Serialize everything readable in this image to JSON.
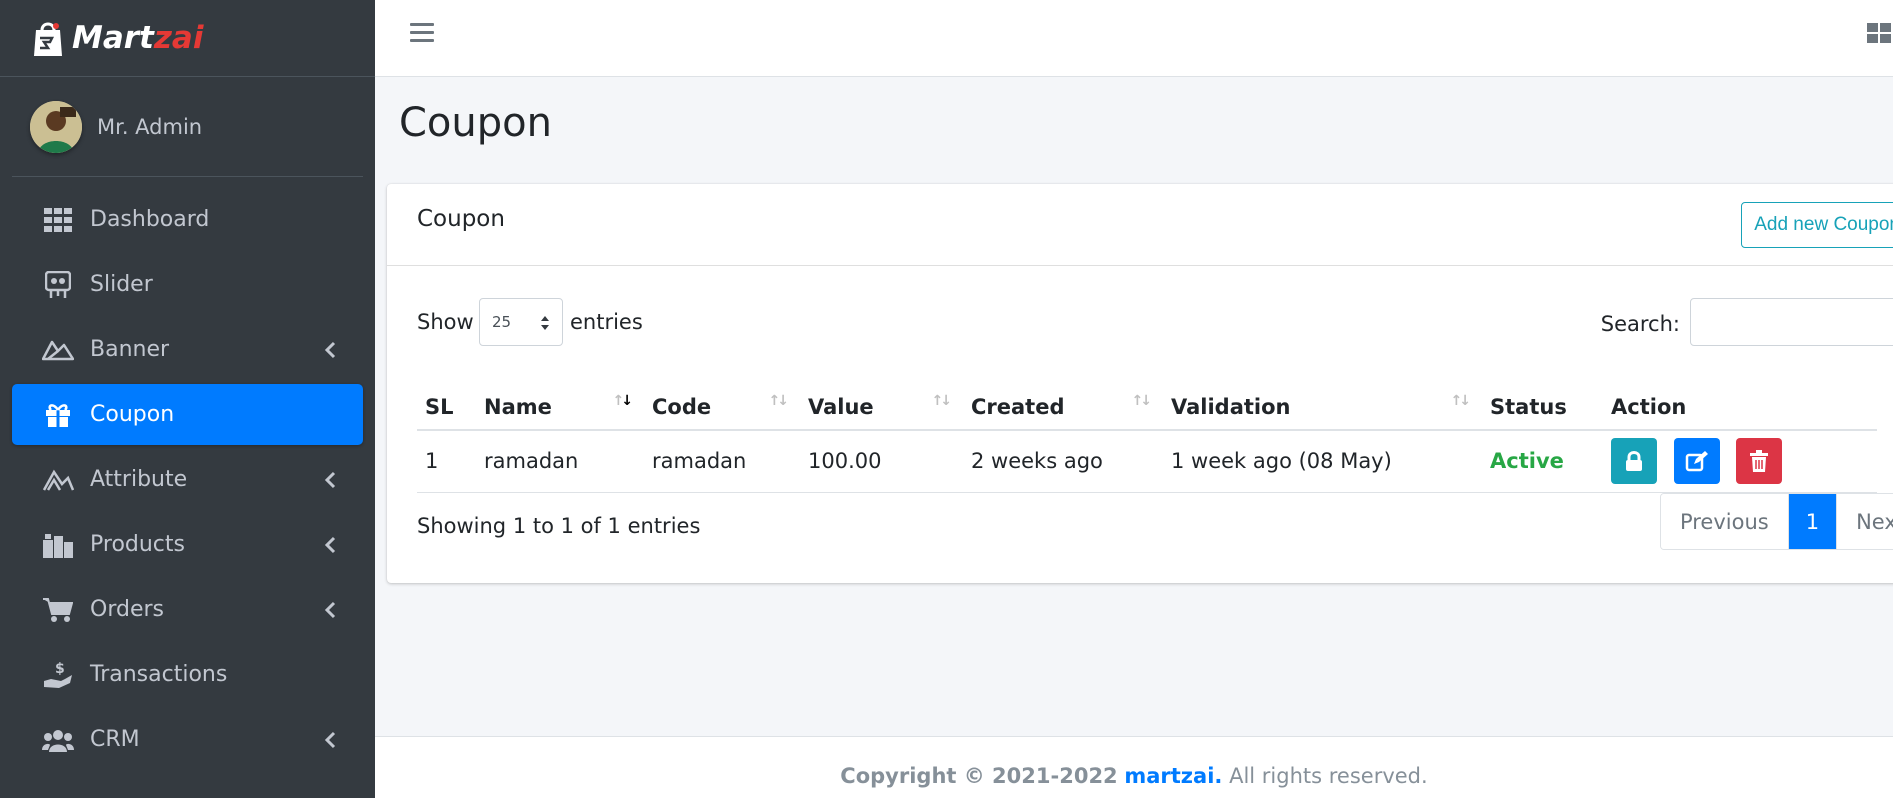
{
  "brand": {
    "part1": "Mart",
    "part2": "zai"
  },
  "user": {
    "name": "Mr. Admin"
  },
  "sidebar": {
    "items": [
      {
        "label": "Dashboard",
        "icon": "th-icon",
        "has_submenu": false
      },
      {
        "label": "Slider",
        "icon": "slider-icon",
        "has_submenu": false
      },
      {
        "label": "Banner",
        "icon": "banner-icon",
        "has_submenu": true
      },
      {
        "label": "Coupon",
        "icon": "gift-icon",
        "has_submenu": false,
        "active": true
      },
      {
        "label": "Attribute",
        "icon": "attribute-icon",
        "has_submenu": true
      },
      {
        "label": "Products",
        "icon": "boxes-icon",
        "has_submenu": true
      },
      {
        "label": "Orders",
        "icon": "cart-icon",
        "has_submenu": true
      },
      {
        "label": "Transactions",
        "icon": "hand-dollar-icon",
        "has_submenu": false
      },
      {
        "label": "CRM",
        "icon": "users-icon",
        "has_submenu": true
      }
    ]
  },
  "page": {
    "title": "Coupon"
  },
  "card": {
    "title": "Coupon",
    "add_button": "Add new Coupon"
  },
  "table_controls": {
    "show_label": "Show",
    "entries_value": "25",
    "entries_label": "entries",
    "search_label": "Search:",
    "search_value": ""
  },
  "table": {
    "columns": [
      "SL",
      "Name",
      "Code",
      "Value",
      "Created",
      "Validation",
      "Status",
      "Action"
    ],
    "rows": [
      {
        "sl": "1",
        "name": "ramadan",
        "code": "ramadan",
        "value": "100.00",
        "created": "2 weeks ago",
        "validation": "1 week ago (08 May)",
        "status": "Active"
      }
    ]
  },
  "pagination": {
    "info": "Showing 1 to 1 of 1 entries",
    "previous": "Previous",
    "current": "1",
    "next": "Next"
  },
  "footer": {
    "copyright": "Copyright © 2021-2022",
    "brand": "martzai.",
    "rights": "All rights reserved."
  },
  "colors": {
    "sidebar_bg": "#343a40",
    "primary": "#007bff",
    "info": "#17a2b8",
    "danger": "#dc3545",
    "success": "#28a745"
  }
}
